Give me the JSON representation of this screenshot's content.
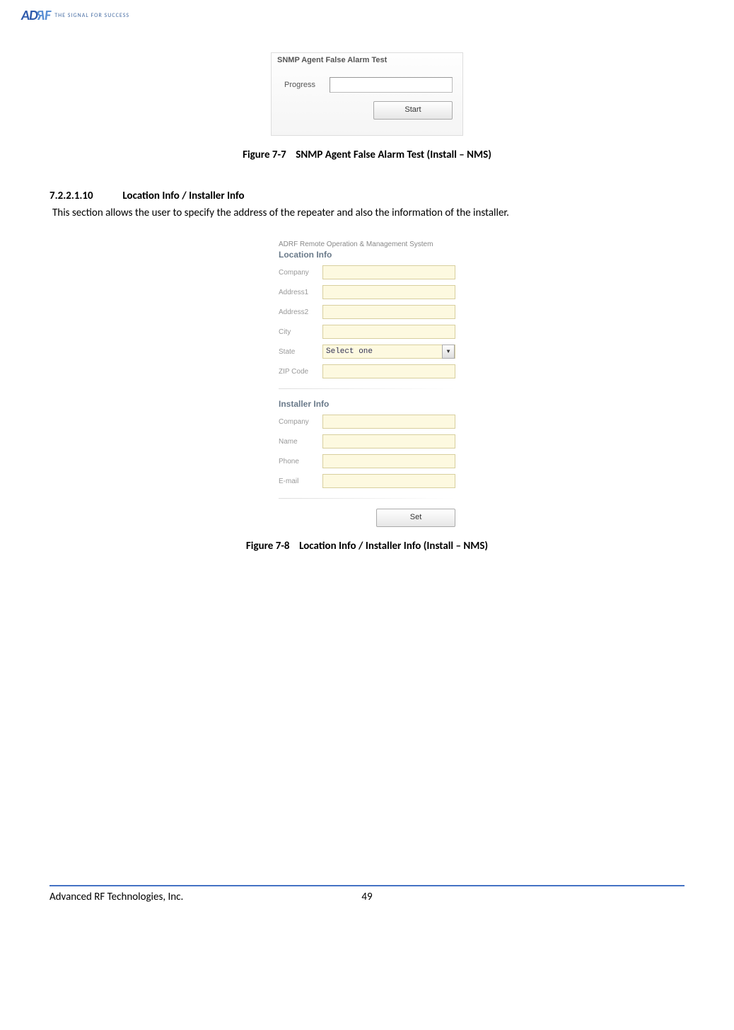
{
  "header": {
    "logo_text": "ADRF",
    "tagline": "THE SIGNAL FOR SUCCESS"
  },
  "figure1": {
    "panel_title": "SNMP Agent False Alarm Test",
    "progress_label": "Progress",
    "progress_value": "",
    "start_button": "Start",
    "caption_prefix": "Figure 7-7",
    "caption_text": "SNMP Agent False Alarm Test (Install – NMS)"
  },
  "section": {
    "number": "7.2.2.1.10",
    "title": "Location Info / Installer Info",
    "body": "This section allows the user to specify the address of the repeater and also the information of the installer."
  },
  "figure2": {
    "supertitle": "ADRF Remote Operation & Management System",
    "location_title": "Location Info",
    "location_fields": {
      "company": {
        "label": "Company",
        "value": ""
      },
      "address1": {
        "label": "Address1",
        "value": ""
      },
      "address2": {
        "label": "Address2",
        "value": ""
      },
      "city": {
        "label": "City",
        "value": ""
      },
      "state": {
        "label": "State",
        "value": "Select one"
      },
      "zip": {
        "label": "ZIP Code",
        "value": ""
      }
    },
    "installer_title": "Installer Info",
    "installer_fields": {
      "company": {
        "label": "Company",
        "value": ""
      },
      "name": {
        "label": "Name",
        "value": ""
      },
      "phone": {
        "label": "Phone",
        "value": ""
      },
      "email": {
        "label": "E-mail",
        "value": ""
      }
    },
    "set_button": "Set",
    "caption_prefix": "Figure 7-8",
    "caption_text": "Location Info / Installer Info (Install – NMS)"
  },
  "footer": {
    "company": "Advanced RF Technologies, Inc.",
    "page": "49"
  }
}
